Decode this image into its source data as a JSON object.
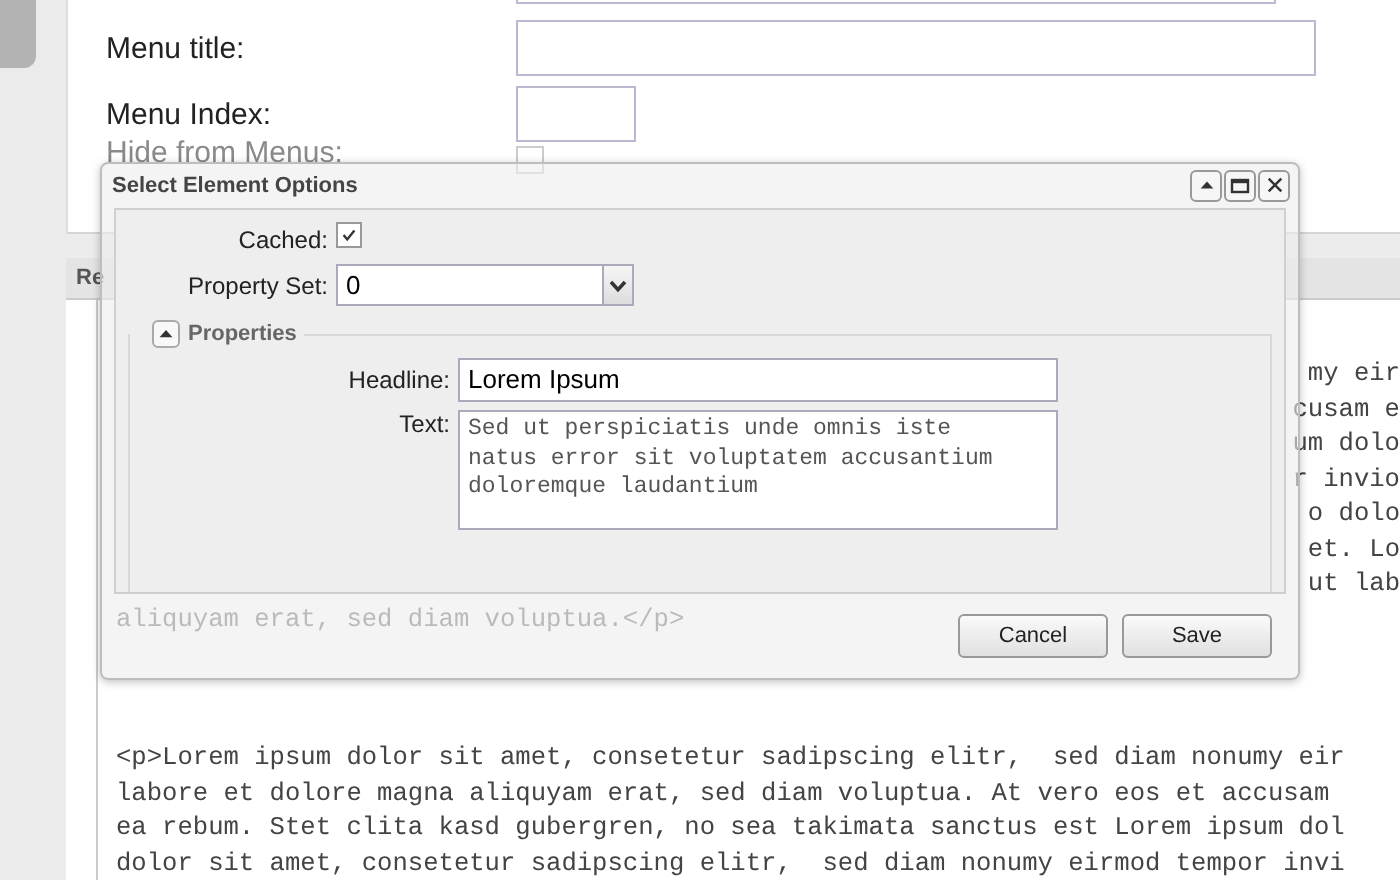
{
  "form": {
    "fields": [
      {
        "kind": "partial"
      },
      {
        "kind": "text",
        "label": "Menu title:"
      },
      {
        "kind": "short",
        "label": "Menu Index:"
      },
      {
        "kind": "checkbox",
        "label": "Hide from Menus:",
        "checked": false
      }
    ]
  },
  "editor": {
    "tab_label": "Re",
    "lines": [
      {
        "kind": "hidden",
        "text": "my eir"
      },
      {
        "kind": "hidden",
        "text": "cusam e"
      },
      {
        "kind": "hidden",
        "text": "um dolo"
      },
      {
        "kind": "hidden",
        "text": "r invio"
      },
      {
        "kind": "hidden",
        "text": "o dolo"
      },
      {
        "kind": "hidden",
        "text": "et. Lo"
      },
      {
        "kind": "hidden",
        "text": "ut lab"
      },
      {
        "kind": "faded",
        "text": "aliquyam erat, sed diam voluptua.</p>"
      },
      {
        "kind": "gap"
      },
      {
        "kind": "full",
        "text": "<p>Lorem ipsum dolor sit amet, consetetur sadipscing elitr,  sed diam nonumy eir"
      },
      {
        "kind": "full",
        "text": "labore et dolore magna aliquyam erat, sed diam voluptua. At vero eos et accusam"
      },
      {
        "kind": "full",
        "text": "ea rebum. Stet clita kasd gubergren, no sea takimata sanctus est Lorem ipsum dol"
      },
      {
        "kind": "full",
        "text": "dolor sit amet, consetetur sadipscing elitr,  sed diam nonumy eirmod tempor invi"
      }
    ]
  },
  "dialog": {
    "title": "Select Element Options",
    "cached": {
      "label": "Cached:",
      "checked": true
    },
    "property_set": {
      "label": "Property Set:",
      "value": "0"
    },
    "properties": {
      "legend": "Properties",
      "expanded": true,
      "headline": {
        "label": "Headline:",
        "value": "Lorem Ipsum"
      },
      "text": {
        "label": "Text:",
        "value": "Sed ut perspiciatis unde omnis iste natus error sit voluptatem accusantium doloremque laudantium"
      }
    },
    "buttons": [
      "Cancel",
      "Save"
    ]
  }
}
